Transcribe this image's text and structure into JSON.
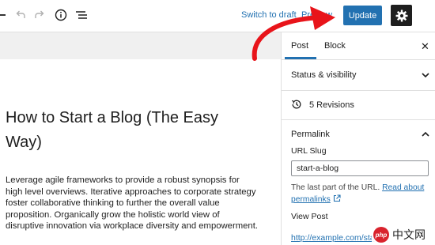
{
  "toolbar": {
    "switch_to_draft": "Switch to draft",
    "preview": "Preview",
    "update": "Update"
  },
  "editor": {
    "title": "How to Start a Blog (The Easy Way)",
    "body": "Leverage agile frameworks to provide a robust synopsis for high level overviews. Iterative approaches to corporate strategy foster collaborative thinking to further the overall value proposition. Organically grow the holistic world view of disruptive innovation via workplace diversity and empowerment."
  },
  "sidebar": {
    "tabs": [
      "Post",
      "Block"
    ],
    "status_visibility": "Status & visibility",
    "revisions": "5 Revisions",
    "permalink": {
      "heading": "Permalink",
      "url_slug_label": "URL Slug",
      "slug_value": "start-a-blog",
      "help_prefix": "The last part of the URL.",
      "help_link": "Read about permalinks",
      "view_post_label": "View Post",
      "view_post_url": "http://example.com/sta"
    }
  },
  "watermark": {
    "badge": "php",
    "text": "中文网"
  },
  "colors": {
    "accent": "#2271b1",
    "annotation": "#e8141a"
  }
}
